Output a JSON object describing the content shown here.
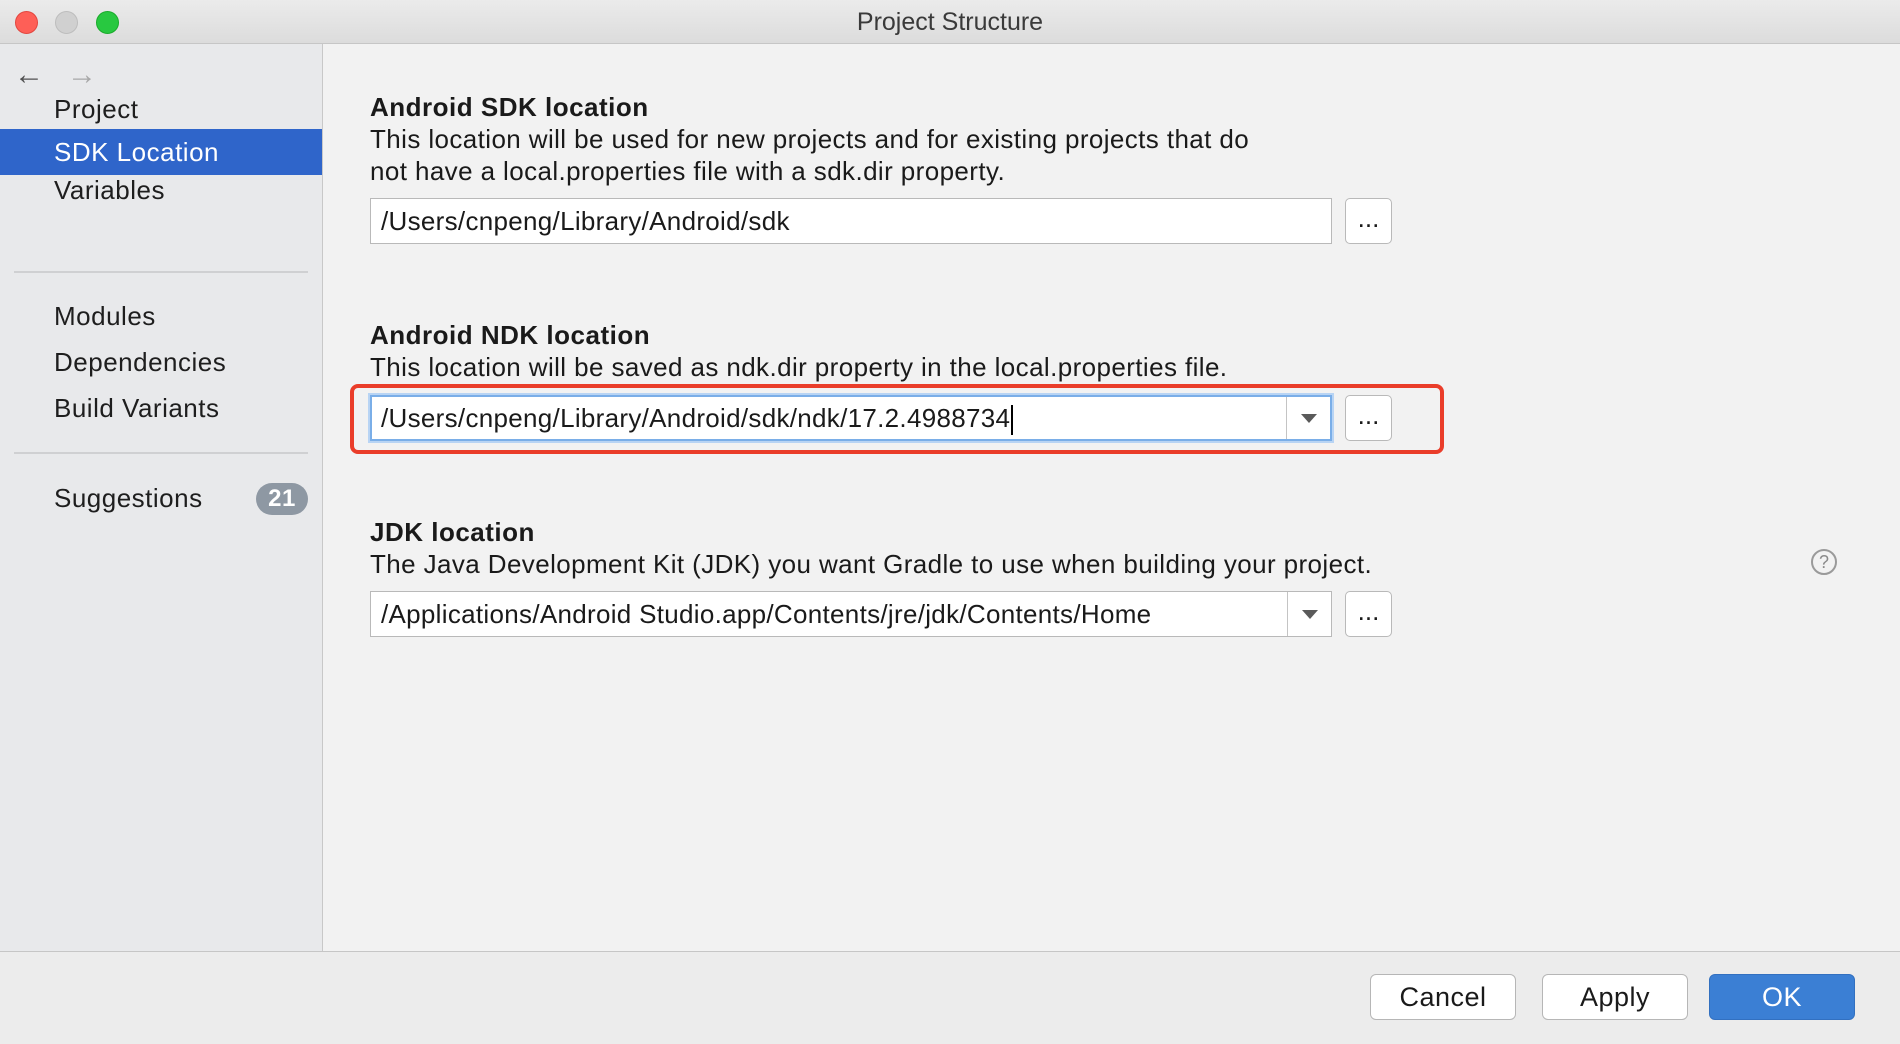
{
  "window": {
    "title": "Project Structure"
  },
  "sidebar": {
    "nav": {
      "back_icon": "←",
      "forward_icon": "→"
    },
    "items": [
      {
        "label": "Project"
      },
      {
        "label": "SDK Location",
        "selected": true
      },
      {
        "label": "Variables"
      },
      {
        "label": "Modules"
      },
      {
        "label": "Dependencies"
      },
      {
        "label": "Build Variants"
      },
      {
        "label": "Suggestions",
        "badge": "21"
      }
    ]
  },
  "sdk": {
    "heading": "Android SDK location",
    "description_line1": "This location will be used for new projects and for existing projects that do",
    "description_line2": "not have a local.properties file with a sdk.dir property.",
    "value": "/Users/cnpeng/Library/Android/sdk",
    "browse_label": "..."
  },
  "ndk": {
    "heading": "Android NDK location",
    "description": "This location will be saved as ndk.dir property in the local.properties file.",
    "value": "/Users/cnpeng/Library/Android/sdk/ndk/17.2.4988734",
    "browse_label": "...",
    "highlight_color": "#ea3d2a"
  },
  "jdk": {
    "heading": "JDK location",
    "description": "The Java Development Kit (JDK) you want Gradle to use when building your project.",
    "help_icon": "?",
    "value": "/Applications/Android Studio.app/Contents/jre/jdk/Contents/Home",
    "browse_label": "..."
  },
  "footer": {
    "cancel_label": "Cancel",
    "apply_label": "Apply",
    "ok_label": "OK"
  },
  "colors": {
    "selection": "#2f65ca",
    "primary_button": "#3b7fd4",
    "badge": "#8e98a3"
  }
}
